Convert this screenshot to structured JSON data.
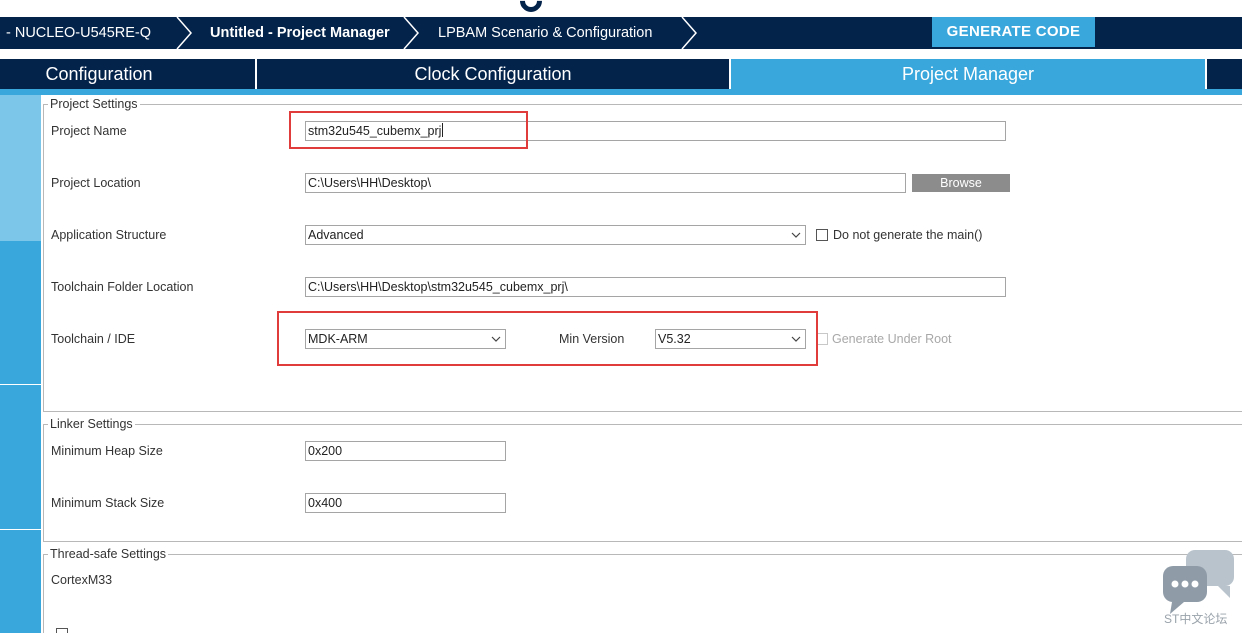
{
  "breadcrumb": {
    "items": [
      {
        "label": "-  NUCLEO-U545RE-Q",
        "bold": false
      },
      {
        "label": "Untitled - Project Manager",
        "bold": true
      },
      {
        "label": "LPBAM Scenario & Configuration",
        "bold": false
      }
    ],
    "generate_label": "GENERATE CODE"
  },
  "tabs": [
    {
      "label": "Configuration",
      "active": false
    },
    {
      "label": "Clock Configuration",
      "active": false
    },
    {
      "label": "Project Manager",
      "active": true
    }
  ],
  "colors": {
    "navy": "#03234b",
    "accent": "#3aa7dc",
    "side_light": "#7cc6ea",
    "highlight": "#e03c3c"
  },
  "project_settings": {
    "legend": "Project Settings",
    "project_name_label": "Project Name",
    "project_name_value": "stm32u545_cubemx_prj",
    "project_location_label": "Project Location",
    "project_location_value": "C:\\Users\\HH\\Desktop\\",
    "browse_label": "Browse",
    "app_structure_label": "Application Structure",
    "app_structure_value": "Advanced",
    "no_main_label": "Do not generate the main()",
    "toolchain_folder_label": "Toolchain Folder Location",
    "toolchain_folder_value": "C:\\Users\\HH\\Desktop\\stm32u545_cubemx_prj\\",
    "toolchain_label": "Toolchain / IDE",
    "toolchain_value": "MDK-ARM",
    "min_version_label": "Min Version",
    "min_version_value": "V5.32",
    "gen_under_root_label": "Generate Under Root"
  },
  "linker_settings": {
    "legend": "Linker Settings",
    "heap_label": "Minimum Heap Size",
    "heap_value": "0x200",
    "stack_label": "Minimum Stack Size",
    "stack_value": "0x400"
  },
  "thread_safe_settings": {
    "legend": "Thread-safe Settings",
    "core_label": "CortexM33"
  },
  "watermark": {
    "text": "ST中文论坛",
    "icon": "chat-bubbles-icon"
  }
}
